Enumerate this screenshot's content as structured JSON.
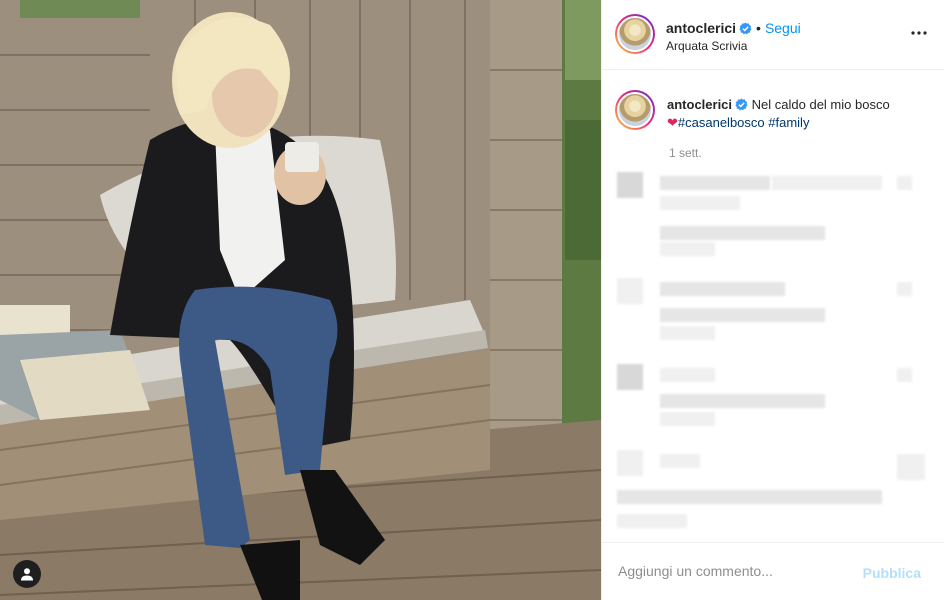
{
  "post": {
    "username": "antoclerici",
    "follow_label": "Segui",
    "separator": "•",
    "location": "Arquata Scrivia",
    "caption": {
      "text": "Nel caldo del mio bosco",
      "heart": "❤",
      "hashtags": [
        "#casanelbosco",
        "#family"
      ]
    },
    "time_ago": "1 sett."
  },
  "add_comment": {
    "placeholder": "Aggiungi un commento...",
    "publish_label": "Pubblica"
  },
  "icons": {
    "verified": "verified-badge-icon",
    "more": "more-options-icon",
    "user_tag": "user-tag-icon"
  },
  "colors": {
    "accent": "#0095f6",
    "publish_disabled": "#b2dffc",
    "hashtag": "#00376b",
    "verified": "#3897f0"
  }
}
